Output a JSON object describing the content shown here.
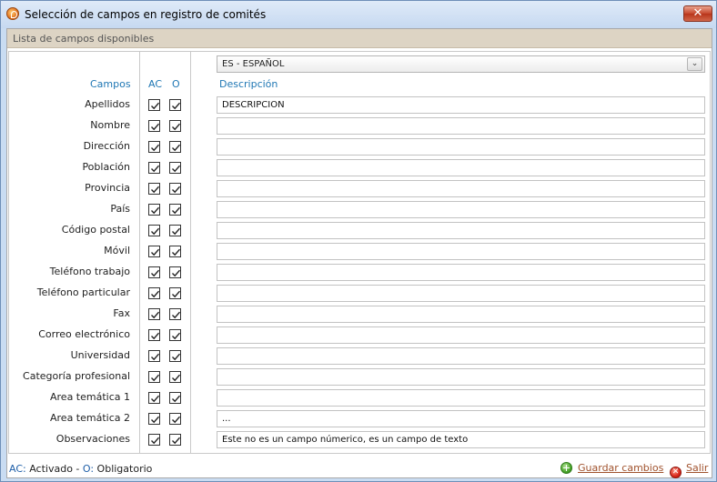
{
  "window": {
    "title": "Selección de campos en registro de comités",
    "close_glyph": "✕"
  },
  "section": {
    "title": "Lista de campos disponibles"
  },
  "columns": {
    "campos": "Campos",
    "ac": "AC",
    "o": "O",
    "descripcion": "Descripción"
  },
  "language": {
    "selected": "ES - ESPAÑOL",
    "arrow_icon": "chevron-down-icon"
  },
  "rows": [
    {
      "label": "Apellidos",
      "ac": true,
      "o": true,
      "value": "DESCRIPCION"
    },
    {
      "label": "Nombre",
      "ac": true,
      "o": true,
      "value": ""
    },
    {
      "label": "Dirección",
      "ac": true,
      "o": true,
      "value": ""
    },
    {
      "label": "Población",
      "ac": true,
      "o": true,
      "value": ""
    },
    {
      "label": "Provincia",
      "ac": true,
      "o": true,
      "value": ""
    },
    {
      "label": "País",
      "ac": true,
      "o": true,
      "value": ""
    },
    {
      "label": "Código postal",
      "ac": true,
      "o": true,
      "value": ""
    },
    {
      "label": "Móvil",
      "ac": true,
      "o": true,
      "value": ""
    },
    {
      "label": "Teléfono trabajo",
      "ac": true,
      "o": true,
      "value": ""
    },
    {
      "label": "Teléfono particular",
      "ac": true,
      "o": true,
      "value": ""
    },
    {
      "label": "Fax",
      "ac": true,
      "o": true,
      "value": ""
    },
    {
      "label": "Correo electrónico",
      "ac": true,
      "o": true,
      "value": ""
    },
    {
      "label": "Universidad",
      "ac": true,
      "o": true,
      "value": ""
    },
    {
      "label": "Categoría profesional",
      "ac": true,
      "o": true,
      "value": ""
    },
    {
      "label": "Area temática 1",
      "ac": true,
      "o": true,
      "value": ""
    },
    {
      "label": "Area temática 2",
      "ac": true,
      "o": true,
      "value": "..."
    },
    {
      "label": "Observaciones",
      "ac": true,
      "o": true,
      "value": "Este no es un campo númerico, es un campo de texto"
    }
  ],
  "footer": {
    "legend_ac_key": "AC:",
    "legend_ac_text": " Activado - ",
    "legend_o_key": "O:",
    "legend_o_text": " Obligatorio",
    "save_label": "Guardar cambios",
    "exit_label": "Salir"
  },
  "colors": {
    "accent_blue": "#1f77b4",
    "link_brown": "#a0522d",
    "header_bg": "#ddd4c4"
  }
}
